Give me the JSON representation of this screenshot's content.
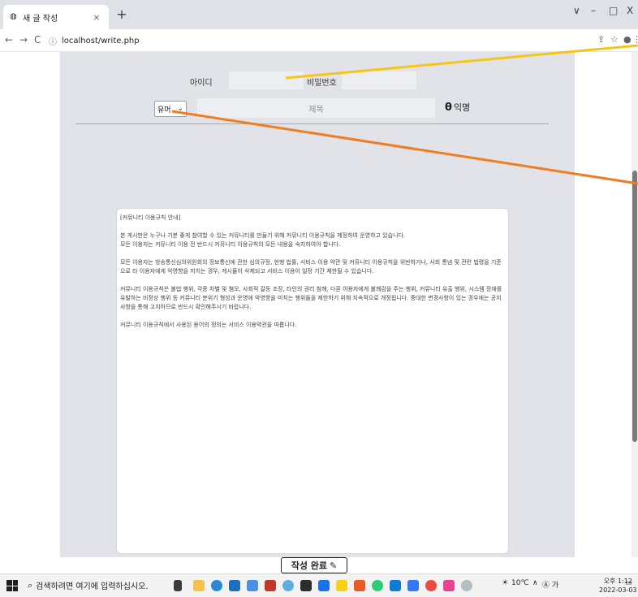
{
  "browser": {
    "tab_title": "새 글 작성",
    "tab_close": "×",
    "new_tab": "+",
    "url": "localhost/write.php",
    "win_controls": [
      "∨",
      "–",
      "□",
      "X"
    ]
  },
  "form": {
    "id_label": "아이디",
    "password_label": "비밀번호",
    "category_selected": "유머",
    "title_placeholder": "제목",
    "anon_label": "익명",
    "submit_label": "작성 완료"
  },
  "editor": {
    "lines": [
      "[커뮤니티 이용규칙 안내]",
      "본 게시판은 누구나 기분 좋게 참여할 수 있는 커뮤니티를 만들기 위해 커뮤니티 이용규칙을 제정하여 운영하고 있습니다.\n모든 이용자는 커뮤니티 이용 전 반드시 커뮤니티 이용규칙의 모든 내용을 숙지하여야 합니다.",
      "모든 이용자는 방송통신심의위원회의 정보통신에 관한 심의규정, 현행 법률, 서비스 이용 약관 및 커뮤니티 이용규칙을 위반하거나, 사회 통념 및 관련 법령을 기준으로 타 이용자에게 악영향을 끼치는 경우, 게시물이 삭제되고 서비스 이용이 일정 기간 제한될 수 있습니다.",
      "커뮤니티 이용규칙은 불법 행위, 각종 차별 및 혐오, 사회적 갈등 조장, 타인의 권리 침해, 다른 이용자에게 불쾌감을 주는 행위, 커뮤니티 유출 행위, 시스템 장애를 유발하는 비정상 행위 등 커뮤니티 분위기 형성과 운영에 악영향을 미치는 행위들을 제한하기 위해 지속적으로 개정됩니다. 중대한 변경사항이 있는 경우에는 공지사항을 통해 고지하므로 반드시 확인해주시기 바랍니다.",
      "커뮤니티 이용규칙에서 사용된 용어의 정의는 서비스 이용약관을 따릅니다."
    ]
  },
  "taskbar": {
    "search_placeholder": "검색하려면 여기에 입력하십시오.",
    "weather": "10℃",
    "ime": "Ⓐ 가",
    "time": "오후 1:12",
    "date": "2022-03-03"
  },
  "colors": {
    "gray_bg": "#e1e3e8",
    "annot_yellow": "#f5c518",
    "annot_orange": "#ef7d22"
  }
}
